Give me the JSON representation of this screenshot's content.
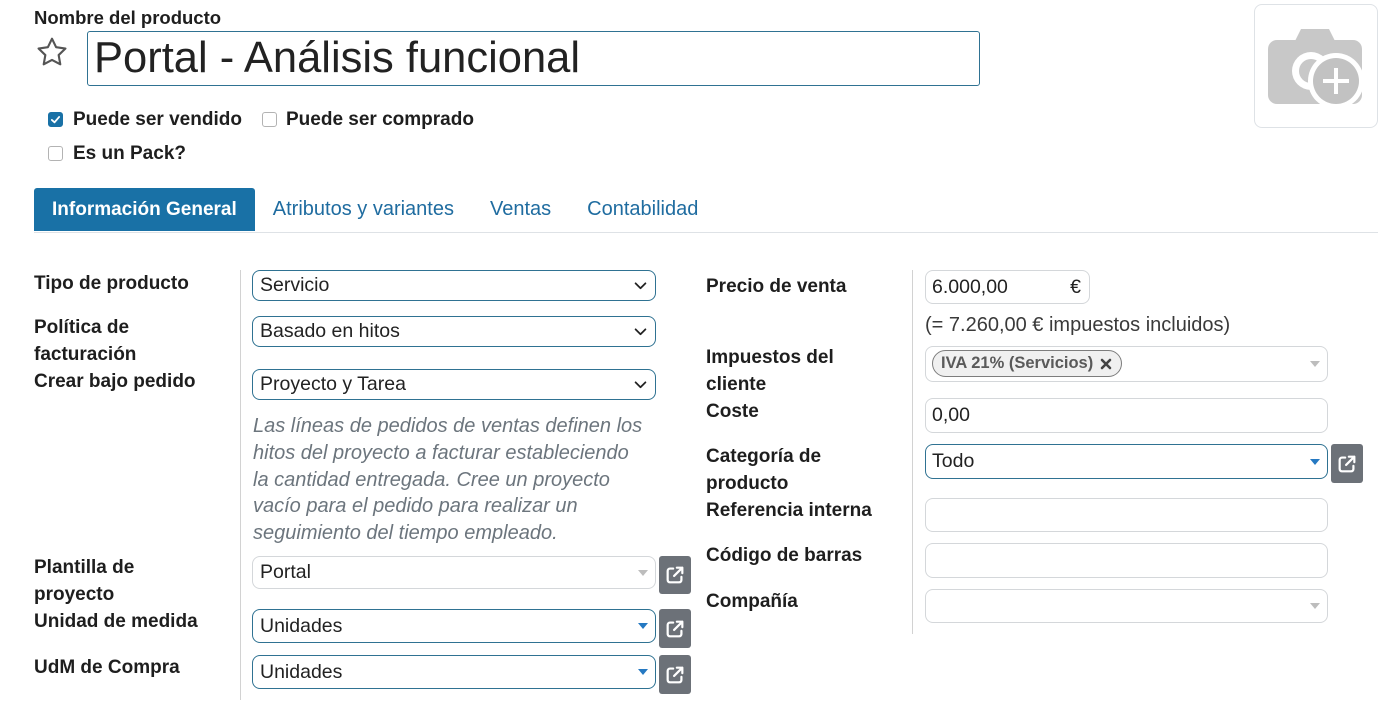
{
  "header": {
    "name_label": "Nombre del producto",
    "name_value": "Portal - Análisis funcional"
  },
  "options": {
    "can_be_sold": {
      "label": "Puede ser vendido",
      "checked": true
    },
    "can_be_purchased": {
      "label": "Puede ser comprado",
      "checked": false
    },
    "is_pack": {
      "label": "Es un Pack?",
      "checked": false
    }
  },
  "tabs": [
    {
      "label": "Información General",
      "active": true
    },
    {
      "label": "Atributos y variantes",
      "active": false
    },
    {
      "label": "Ventas",
      "active": false
    },
    {
      "label": "Contabilidad",
      "active": false
    }
  ],
  "general": {
    "left": {
      "product_type": {
        "label": "Tipo de producto",
        "value": "Servicio"
      },
      "invoice_policy": {
        "label": "Política de facturación",
        "value": "Basado en hitos"
      },
      "create_on_order": {
        "label": "Crear bajo pedido",
        "value": "Proyecto y Tarea",
        "help": "Las líneas de pedidos de ventas definen los hitos del proyecto a facturar estableciendo la cantidad entregada. Cree un proyecto vacío para el pedido para realizar un seguimiento del tiempo empleado."
      },
      "project_template": {
        "label": "Plantilla de proyecto",
        "value": "Portal"
      },
      "uom": {
        "label": "Unidad de medida",
        "value": "Unidades"
      },
      "purchase_uom": {
        "label": "UdM de Compra",
        "value": "Unidades"
      }
    },
    "right": {
      "list_price": {
        "label": "Precio de venta",
        "value": "6.000,00",
        "currency": "€",
        "tax_included_note": "(= 7.260,00 € impuestos incluidos)"
      },
      "customer_taxes": {
        "label": "Impuestos del cliente",
        "tags": [
          "IVA 21% (Servicios)"
        ]
      },
      "cost": {
        "label": "Coste",
        "value": "0,00"
      },
      "category": {
        "label": "Categoría de producto",
        "value": "Todo"
      },
      "internal_reference": {
        "label": "Referencia interna"
      },
      "barcode": {
        "label": "Código de barras"
      },
      "company": {
        "label": "Compañía"
      }
    }
  },
  "icons": {
    "favorite": "star-icon",
    "image_placeholder": "camera-plus-icon",
    "checkbox_checked": "check-icon",
    "select_toggle": "chevron-down-icon",
    "many2one_toggle": "caret-down-icon",
    "open_record": "external-link-icon",
    "tag_remove": "close-icon"
  },
  "colors": {
    "accent": "#1971a6",
    "tab_link": "#1f6ca0",
    "field_focus_border": "#2f7292",
    "field_border": "#d4d7da",
    "caret_blue": "#2579c2",
    "help_text": "#6c757d",
    "button_gray": "#6c7178"
  }
}
